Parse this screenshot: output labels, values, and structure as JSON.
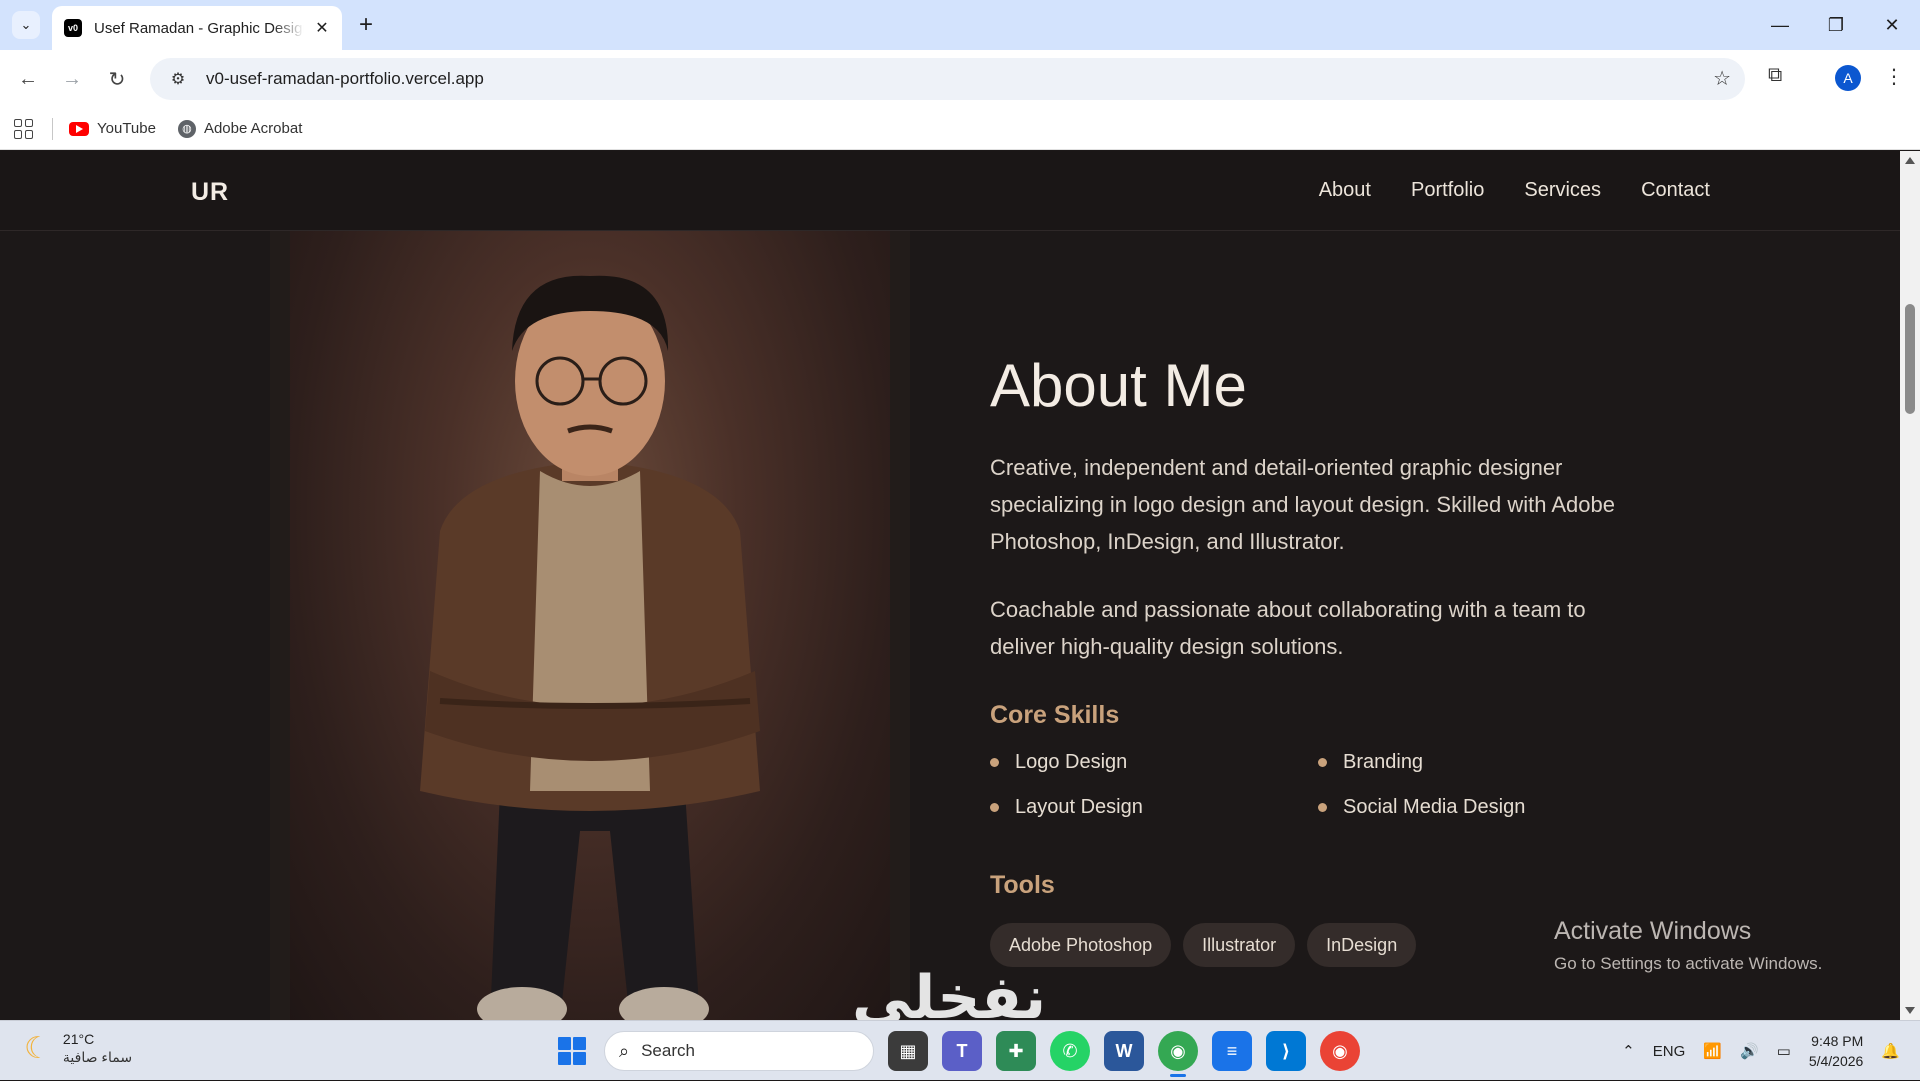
{
  "browser": {
    "tab_title": "Usef Ramadan - Graphic Design",
    "url": "v0-usef-ramadan-portfolio.vercel.app",
    "avatar_initial": "A",
    "bookmarks": [
      {
        "label": "YouTube",
        "icon": "youtube-icon"
      },
      {
        "label": "Adobe Acrobat",
        "icon": "globe-icon"
      }
    ]
  },
  "site": {
    "logo": "UR",
    "nav": [
      "About",
      "Portfolio",
      "Services",
      "Contact"
    ],
    "about": {
      "title": "About Me",
      "paragraph1": "Creative, independent and detail-oriented graphic designer specializing in logo design and layout design. Skilled with Adobe Photoshop, InDesign, and Illustrator.",
      "paragraph2": "Coachable and passionate about collaborating with a team to deliver high-quality design solutions.",
      "skills_heading": "Core Skills",
      "skills": [
        "Logo Design",
        "Branding",
        "Layout Design",
        "Social Media Design"
      ],
      "tools_heading": "Tools",
      "tools": [
        "Adobe Photoshop",
        "Illustrator",
        "InDesign"
      ]
    },
    "accent_color": "#c9a27c"
  },
  "overlay": {
    "activation_title": "Activate Windows",
    "activation_sub": "Go to Settings to activate Windows.",
    "arabic_logo": "نفخلي"
  },
  "taskbar": {
    "weather_temp": "21°C",
    "weather_desc": "سماء صافية",
    "search_placeholder": "Search",
    "language": "ENG",
    "time": "9:48 PM",
    "date": "5/4/2026"
  }
}
